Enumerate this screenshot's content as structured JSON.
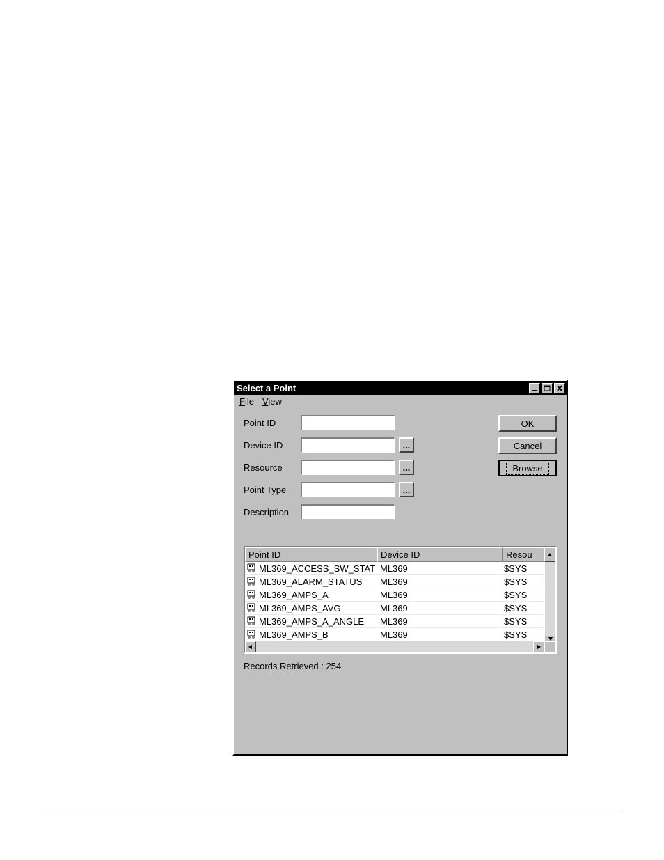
{
  "dialog": {
    "title": "Select a Point",
    "menubar": {
      "file": "File",
      "view": "View"
    },
    "form": {
      "point_id_label": "Point ID",
      "point_id_value": "",
      "device_id_label": "Device ID",
      "device_id_value": "",
      "resource_label": "Resource",
      "resource_value": "",
      "point_type_label": "Point Type",
      "point_type_value": "",
      "description_label": "Description",
      "description_value": "",
      "ellipsis": "..."
    },
    "buttons": {
      "ok": "OK",
      "cancel": "Cancel",
      "browse": "Browse"
    },
    "table": {
      "headers": {
        "point_id": "Point ID",
        "device_id": "Device ID",
        "resource": "Resou"
      },
      "rows": [
        {
          "point_id": "ML369_ACCESS_SW_STAT",
          "device_id": "ML369",
          "resource": "$SYS"
        },
        {
          "point_id": "ML369_ALARM_STATUS",
          "device_id": "ML369",
          "resource": "$SYS"
        },
        {
          "point_id": "ML369_AMPS_A",
          "device_id": "ML369",
          "resource": "$SYS"
        },
        {
          "point_id": "ML369_AMPS_AVG",
          "device_id": "ML369",
          "resource": "$SYS"
        },
        {
          "point_id": "ML369_AMPS_A_ANGLE",
          "device_id": "ML369",
          "resource": "$SYS"
        },
        {
          "point_id": "ML369_AMPS_B",
          "device_id": "ML369",
          "resource": "$SYS"
        }
      ]
    },
    "status": "Records Retrieved : 254"
  }
}
